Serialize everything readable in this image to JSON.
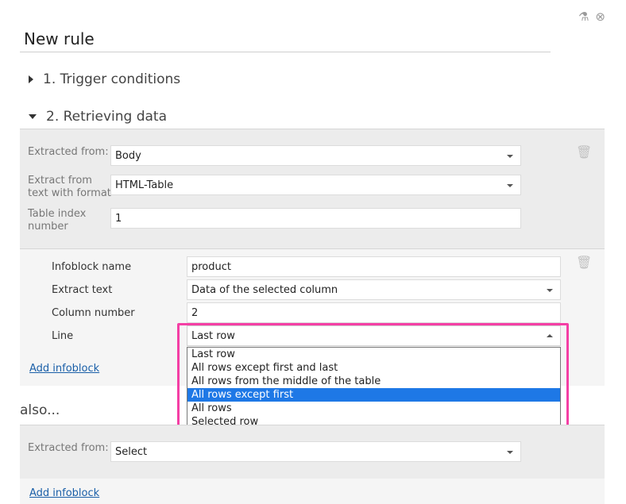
{
  "rule_title": "New rule",
  "sections": {
    "trigger": "1. Trigger conditions",
    "retrieving": "2. Retrieving data"
  },
  "panel1": {
    "extracted_from_label": "Extracted from:",
    "extracted_from_value": "Body",
    "format_label_1": "Extract from",
    "format_label_2": "text with format",
    "format_value": "HTML-Table",
    "table_index_label_1": "Table index",
    "table_index_label_2": "number",
    "table_index_value": "1"
  },
  "infoblock": {
    "name_label": "Infoblock name",
    "name_value": "product",
    "extract_label": "Extract text",
    "extract_value": "Data of the selected column",
    "column_label": "Column number",
    "column_value": "2",
    "line_label": "Line",
    "line_value": "Last row",
    "line_options": [
      "Last row",
      "All rows except first and last",
      "All rows from the middle of the table",
      "All rows except first",
      "All rows",
      "Selected row"
    ],
    "add_link": "Add infoblock"
  },
  "also": {
    "heading": "also...",
    "extracted_from_label": "Extracted from:",
    "extracted_from_value": "Select",
    "add_link": "Add infoblock"
  },
  "icons": {
    "flask": "flask-icon",
    "close": "close-circle-icon",
    "trash": "trash-icon"
  },
  "colors": {
    "highlight": "#f43fa5",
    "selected_option": "#1e78e6",
    "link": "#1a5fa8"
  }
}
